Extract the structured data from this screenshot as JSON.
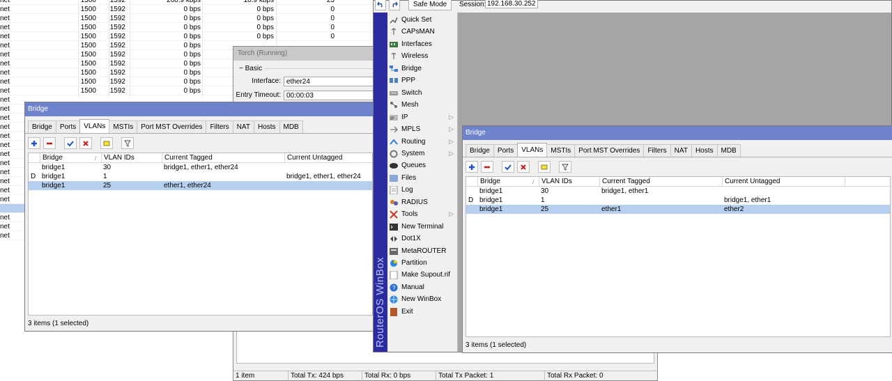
{
  "background_table": {
    "rows": [
      [
        "net",
        "1500",
        "1592",
        "260.9 kbps",
        "10.9 kbps",
        "23"
      ],
      [
        "net",
        "1500",
        "1592",
        "0 bps",
        "0 bps",
        "0"
      ],
      [
        "net",
        "1500",
        "1592",
        "0 bps",
        "0 bps",
        "0"
      ],
      [
        "net",
        "1500",
        "1592",
        "0 bps",
        "0 bps",
        "0"
      ],
      [
        "net",
        "1500",
        "1592",
        "0 bps",
        "0 bps",
        "0"
      ],
      [
        "net",
        "1500",
        "1592",
        "0 bps",
        "",
        ""
      ],
      [
        "net",
        "1500",
        "1592",
        "0 bps",
        "",
        ""
      ],
      [
        "net",
        "1500",
        "1592",
        "0 bps",
        "",
        ""
      ],
      [
        "net",
        "1500",
        "1592",
        "0 bps",
        "",
        ""
      ],
      [
        "net",
        "1500",
        "1592",
        "0 bps",
        "",
        ""
      ],
      [
        "net",
        "1500",
        "1592",
        "0 bps",
        "",
        ""
      ],
      [
        "net",
        "",
        "",
        "",
        "",
        ""
      ],
      [
        "net",
        "",
        "",
        "",
        "",
        ""
      ],
      [
        "net",
        "",
        "",
        "",
        "",
        ""
      ],
      [
        "net",
        "",
        "",
        "",
        "",
        ""
      ],
      [
        "net",
        "",
        "",
        "",
        "",
        ""
      ],
      [
        "net",
        "",
        "",
        "",
        "",
        ""
      ],
      [
        "net",
        "",
        "",
        "",
        "",
        ""
      ],
      [
        "net",
        "",
        "",
        "",
        "",
        ""
      ],
      [
        "net",
        "",
        "",
        "",
        "",
        ""
      ],
      [
        "net",
        "",
        "",
        "",
        "",
        ""
      ],
      [
        "net",
        "",
        "",
        "",
        "",
        ""
      ],
      [
        "net",
        "",
        "",
        "",
        "",
        ""
      ],
      [
        "",
        "",
        "",
        "",
        "",
        ""
      ],
      [
        "net",
        "",
        "",
        "",
        "",
        ""
      ],
      [
        "net",
        "",
        "",
        "",
        "",
        ""
      ],
      [
        "net",
        "",
        "",
        "",
        "",
        ""
      ]
    ]
  },
  "torch": {
    "title": "Torch (Running)",
    "group": "Basic",
    "interface_label": "Interface:",
    "interface_value": "ether24",
    "timeout_label": "Entry Timeout:",
    "timeout_value": "00:00:03",
    "status": [
      "1 item",
      "Total Tx: 424 bps",
      "Total Rx: 0 bps",
      "Total Tx Packet: 1",
      "Total Rx Packet: 0"
    ]
  },
  "bridge_left": {
    "title": "Bridge",
    "tabs": [
      "Bridge",
      "Ports",
      "VLANs",
      "MSTIs",
      "Port MST Overrides",
      "Filters",
      "NAT",
      "Hosts",
      "MDB"
    ],
    "columns": [
      "Bridge",
      "VLAN IDs",
      "Current Tagged",
      "Current Untagged"
    ],
    "rows": [
      {
        "flag": "",
        "bridge": "bridge1",
        "vlan": "30",
        "tagged": "bridge1, ether1, ether24",
        "untagged": ""
      },
      {
        "flag": "D",
        "bridge": "bridge1",
        "vlan": "1",
        "tagged": "",
        "untagged": "bridge1, ether1, ether24"
      },
      {
        "flag": "",
        "bridge": "bridge1",
        "vlan": "25",
        "tagged": "ether1, ether24",
        "untagged": ""
      }
    ],
    "status": "3 items (1 selected)"
  },
  "winbox": {
    "safe_mode": "Safe Mode",
    "session_label": "Session:",
    "session_value": "192.168.30.252",
    "brand": "RouterOS WinBox",
    "menu": [
      {
        "label": "Quick Set",
        "icon": "quick-set-icon",
        "arrow": false
      },
      {
        "label": "CAPsMAN",
        "icon": "capsman-icon",
        "arrow": false
      },
      {
        "label": "Interfaces",
        "icon": "interfaces-icon",
        "arrow": false
      },
      {
        "label": "Wireless",
        "icon": "wireless-icon",
        "arrow": false
      },
      {
        "label": "Bridge",
        "icon": "bridge-icon",
        "arrow": false
      },
      {
        "label": "PPP",
        "icon": "ppp-icon",
        "arrow": false
      },
      {
        "label": "Switch",
        "icon": "switch-icon",
        "arrow": false
      },
      {
        "label": "Mesh",
        "icon": "mesh-icon",
        "arrow": false
      },
      {
        "label": "IP",
        "icon": "ip-icon",
        "arrow": true
      },
      {
        "label": "MPLS",
        "icon": "mpls-icon",
        "arrow": true
      },
      {
        "label": "Routing",
        "icon": "routing-icon",
        "arrow": true
      },
      {
        "label": "System",
        "icon": "system-icon",
        "arrow": true
      },
      {
        "label": "Queues",
        "icon": "queues-icon",
        "arrow": false
      },
      {
        "label": "Files",
        "icon": "files-icon",
        "arrow": false
      },
      {
        "label": "Log",
        "icon": "log-icon",
        "arrow": false
      },
      {
        "label": "RADIUS",
        "icon": "radius-icon",
        "arrow": false
      },
      {
        "label": "Tools",
        "icon": "tools-icon",
        "arrow": true
      },
      {
        "label": "New Terminal",
        "icon": "terminal-icon",
        "arrow": false
      },
      {
        "label": "Dot1X",
        "icon": "dot1x-icon",
        "arrow": false
      },
      {
        "label": "MetaROUTER",
        "icon": "metarouter-icon",
        "arrow": false
      },
      {
        "label": "Partition",
        "icon": "partition-icon",
        "arrow": false
      },
      {
        "label": "Make Supout.rif",
        "icon": "supout-icon",
        "arrow": false
      },
      {
        "label": "Manual",
        "icon": "manual-icon",
        "arrow": false
      },
      {
        "label": "New WinBox",
        "icon": "new-winbox-icon",
        "arrow": false
      },
      {
        "label": "Exit",
        "icon": "exit-icon",
        "arrow": false
      }
    ]
  },
  "bridge_right": {
    "title": "Bridge",
    "tabs": [
      "Bridge",
      "Ports",
      "VLANs",
      "MSTIs",
      "Port MST Overrides",
      "Filters",
      "NAT",
      "Hosts",
      "MDB"
    ],
    "columns": [
      "Bridge",
      "VLAN IDs",
      "Current Tagged",
      "Current Untagged"
    ],
    "rows": [
      {
        "flag": "",
        "bridge": "bridge1",
        "vlan": "30",
        "tagged": "bridge1, ether1",
        "untagged": ""
      },
      {
        "flag": "D",
        "bridge": "bridge1",
        "vlan": "1",
        "tagged": "",
        "untagged": "bridge1, ether1"
      },
      {
        "flag": "",
        "bridge": "bridge1",
        "vlan": "25",
        "tagged": "ether1",
        "untagged": "ether2"
      }
    ],
    "status": "3 items (1 selected)"
  },
  "colors": {
    "titlebar": "#6f82cc",
    "selection": "#b7cfee",
    "brand_bar": "#2c2ca0",
    "workspace": "#a5a5a5",
    "add": "#1f4fc4",
    "remove": "#c41b1b"
  }
}
